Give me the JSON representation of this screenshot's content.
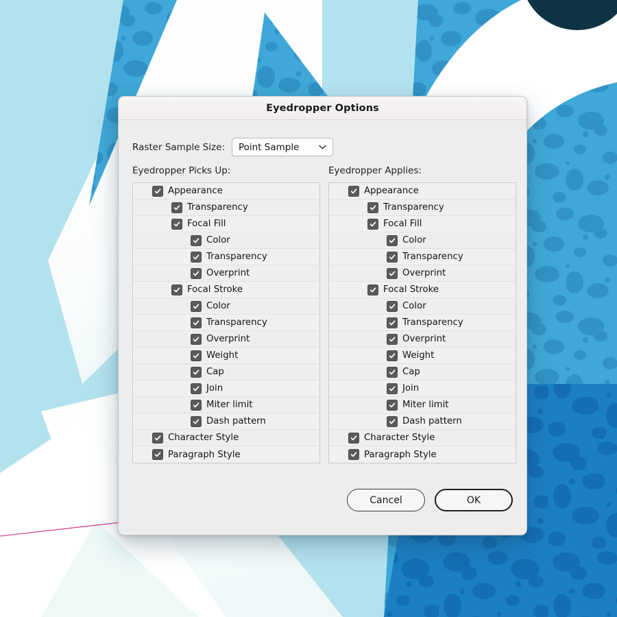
{
  "window": {
    "title": "Eyedropper Options"
  },
  "form": {
    "raster_sample_label": "Raster Sample Size:",
    "raster_sample_value": "Point Sample",
    "raster_sample_options": [
      "Point Sample"
    ],
    "dropdown_icon": "chevron-down-icon"
  },
  "columns": {
    "picks_up_label": "Eyedropper Picks Up:",
    "applies_label": "Eyedropper Applies:"
  },
  "picks_up_items": [
    {
      "label": "Appearance",
      "level": 0,
      "checked": true
    },
    {
      "label": "Transparency",
      "level": 1,
      "checked": true
    },
    {
      "label": "Focal Fill",
      "level": 1,
      "checked": true
    },
    {
      "label": "Color",
      "level": 2,
      "checked": true
    },
    {
      "label": "Transparency",
      "level": 2,
      "checked": true
    },
    {
      "label": "Overprint",
      "level": 2,
      "checked": true
    },
    {
      "label": "Focal Stroke",
      "level": 1,
      "checked": true
    },
    {
      "label": "Color",
      "level": 2,
      "checked": true
    },
    {
      "label": "Transparency",
      "level": 2,
      "checked": true
    },
    {
      "label": "Overprint",
      "level": 2,
      "checked": true
    },
    {
      "label": "Weight",
      "level": 2,
      "checked": true
    },
    {
      "label": "Cap",
      "level": 2,
      "checked": true
    },
    {
      "label": "Join",
      "level": 2,
      "checked": true
    },
    {
      "label": "Miter limit",
      "level": 2,
      "checked": true
    },
    {
      "label": "Dash pattern",
      "level": 2,
      "checked": true
    },
    {
      "label": "Character Style",
      "level": 0,
      "checked": true
    },
    {
      "label": "Paragraph Style",
      "level": 0,
      "checked": true
    }
  ],
  "applies_items": [
    {
      "label": "Appearance",
      "level": 0,
      "checked": true
    },
    {
      "label": "Transparency",
      "level": 1,
      "checked": true
    },
    {
      "label": "Focal Fill",
      "level": 1,
      "checked": true
    },
    {
      "label": "Color",
      "level": 2,
      "checked": true
    },
    {
      "label": "Transparency",
      "level": 2,
      "checked": true
    },
    {
      "label": "Overprint",
      "level": 2,
      "checked": true
    },
    {
      "label": "Focal Stroke",
      "level": 1,
      "checked": true
    },
    {
      "label": "Color",
      "level": 2,
      "checked": true
    },
    {
      "label": "Transparency",
      "level": 2,
      "checked": true
    },
    {
      "label": "Overprint",
      "level": 2,
      "checked": true
    },
    {
      "label": "Weight",
      "level": 2,
      "checked": true
    },
    {
      "label": "Cap",
      "level": 2,
      "checked": true
    },
    {
      "label": "Join",
      "level": 2,
      "checked": true
    },
    {
      "label": "Miter limit",
      "level": 2,
      "checked": true
    },
    {
      "label": "Dash pattern",
      "level": 2,
      "checked": true
    },
    {
      "label": "Character Style",
      "level": 0,
      "checked": true
    },
    {
      "label": "Paragraph Style",
      "level": 0,
      "checked": true
    }
  ],
  "buttons": {
    "cancel_label": "Cancel",
    "ok_label": "OK"
  },
  "colors": {
    "canvas_cyan": "#b3e2ef",
    "shape_blue": "#3fa8d8",
    "shape_blue_dark": "#1b7fc4",
    "blob_accent": "#2f8ec2",
    "circle_navy": "#0d3344",
    "guide_magenta": "#d24a8e",
    "checkbox_fill": "#5a5a5a",
    "dialog_bg": "#ededed",
    "titlebar_bg": "#f5f2f2"
  }
}
